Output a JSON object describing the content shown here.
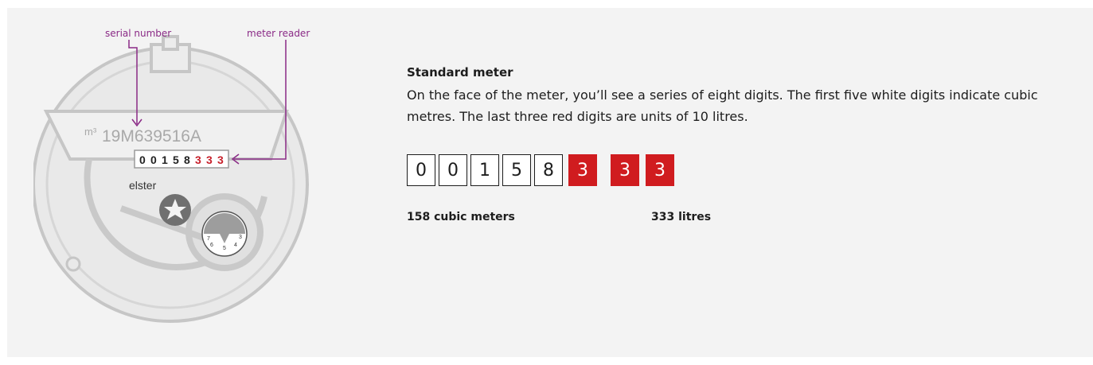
{
  "meter": {
    "label_serial": "serial number",
    "label_reader": "meter reader",
    "serial_unit": "m³",
    "serial_number": "19M639516A",
    "counter_white": [
      "0",
      "0",
      "1",
      "5",
      "8"
    ],
    "counter_red": [
      "3",
      "3",
      "3"
    ],
    "brand": "elster",
    "dial_numbers": [
      "7",
      "6",
      "5",
      "4",
      "3"
    ]
  },
  "info": {
    "title": "Standard meter",
    "description": "On the face of the meter, you’ll see a series of eight digits. The first five white digits indicate cubic metres. The last three red digits are units of 10 litres."
  },
  "reading": {
    "white_digits": [
      "0",
      "0",
      "1",
      "5",
      "8"
    ],
    "red_digits": [
      "3",
      "3",
      "3"
    ],
    "caption_white": "158 cubic meters",
    "caption_red": "333 litres"
  },
  "colors": {
    "panel_bg": "#f3f3f3",
    "accent_red": "#d01c1f",
    "annotation_purple": "#8a2a86",
    "meter_grey": "#c8c8c8"
  }
}
